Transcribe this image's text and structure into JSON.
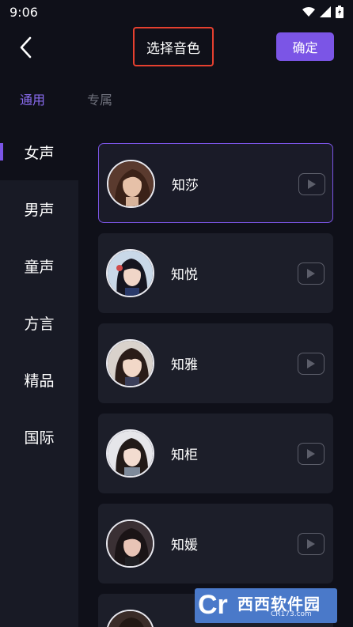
{
  "status": {
    "time": "9:06"
  },
  "header": {
    "title": "选择音色",
    "confirm_label": "确定"
  },
  "tabs": [
    {
      "label": "通用",
      "active": true
    },
    {
      "label": "专属",
      "active": false
    }
  ],
  "sidebar": {
    "items": [
      {
        "label": "女声",
        "active": true
      },
      {
        "label": "男声",
        "active": false
      },
      {
        "label": "童声",
        "active": false
      },
      {
        "label": "方言",
        "active": false
      },
      {
        "label": "精品",
        "active": false
      },
      {
        "label": "国际",
        "active": false
      }
    ]
  },
  "voices": [
    {
      "name": "知莎",
      "selected": true
    },
    {
      "name": "知悦",
      "selected": false
    },
    {
      "name": "知雅",
      "selected": false
    },
    {
      "name": "知柜",
      "selected": false
    },
    {
      "name": "知媛",
      "selected": false
    }
  ],
  "watermark": {
    "logo": "Cr",
    "name": "西西软件园",
    "site": "CR173.com"
  },
  "colors": {
    "accent": "#7b55e6",
    "highlight_border": "#e5402f",
    "background": "#0f1019",
    "card": "#1c1e29"
  }
}
